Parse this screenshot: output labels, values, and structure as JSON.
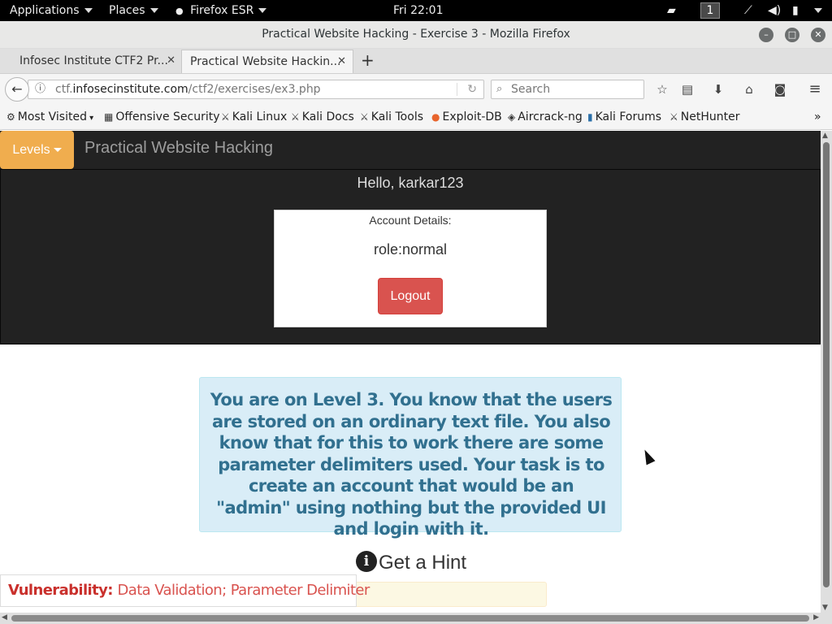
{
  "topbar": {
    "applications": "Applications",
    "places": "Places",
    "firefox": "Firefox ESR",
    "clock": "Fri 22:01",
    "workspace": "1"
  },
  "window": {
    "title": "Practical Website Hacking - Exercise 3 - Mozilla Firefox"
  },
  "tabs": [
    {
      "label": "Infosec Institute CTF2 Pr..."
    },
    {
      "label": "Practical Website Hackin..."
    }
  ],
  "nav": {
    "url_prefix": "ctf.",
    "url_domain": "infosecinstitute.com",
    "url_path": "/ctf2/exercises/ex3.php",
    "search_placeholder": "Search"
  },
  "bookmarks": [
    {
      "label": "Most Visited",
      "icon": "gear-icon"
    },
    {
      "label": "Offensive Security",
      "icon": "offsec-icon"
    },
    {
      "label": "Kali Linux",
      "icon": "kali-dragon-icon"
    },
    {
      "label": "Kali Docs",
      "icon": "kali-dragon-icon"
    },
    {
      "label": "Kali Tools",
      "icon": "kali-dragon-icon"
    },
    {
      "label": "Exploit-DB",
      "icon": "exploitdb-icon"
    },
    {
      "label": "Aircrack-ng",
      "icon": "aircrack-icon"
    },
    {
      "label": "Kali Forums",
      "icon": "kali-forums-icon"
    },
    {
      "label": "NetHunter",
      "icon": "kali-dragon-icon"
    }
  ],
  "site": {
    "levels_label": "Levels",
    "brand": "Practical Website Hacking",
    "hello": "Hello, karkar123",
    "account_label": "Account Details:",
    "role": "role:normal",
    "logout_label": "Logout",
    "level_text": "You are on Level 3. You know that the users are stored on an ordinary text file. You also know that for this to work there are some parameter delimiters used. Your task is to create an account that would be an \"admin\" using nothing but the provided UI and login with it.",
    "hint_label": "Get a Hint",
    "vuln_label": "Vulnerability:",
    "vuln_value": "Data Validation; Parameter Delimiter"
  },
  "colors": {
    "levels_button": "#f0ad4e",
    "logout_button": "#d9534f",
    "info_box": "#d9edf7",
    "info_text": "#31708f",
    "vuln_text": "#c9302c"
  }
}
